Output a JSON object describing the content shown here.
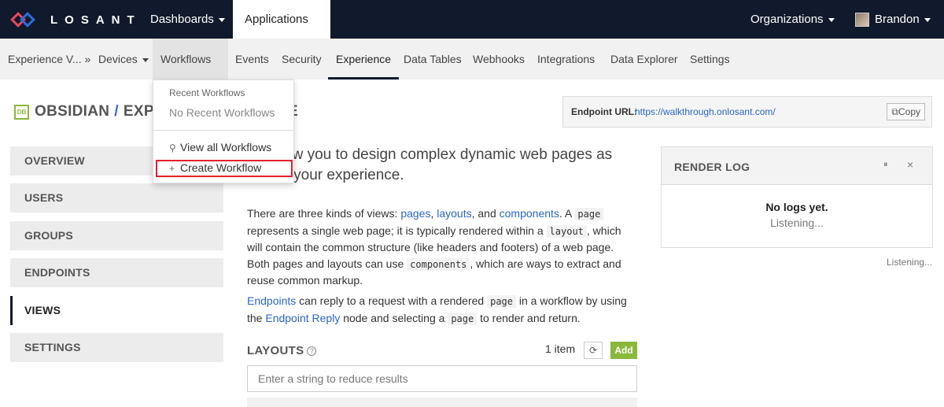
{
  "topbar": {
    "brand": "LOSANT",
    "nav": [
      "Dashboards",
      "Applications"
    ],
    "organizations": "Organizations",
    "user": "Brandon"
  },
  "subnav": {
    "items": [
      "Experience V... »",
      "Devices",
      "Workflows",
      "Events",
      "Security",
      "Experience",
      "Data Tables",
      "Webhooks",
      "Integrations",
      "Data Explorer",
      "Settings"
    ],
    "active": "Experience"
  },
  "dropdown": {
    "header": "Recent Workflows",
    "empty": "No Recent Workflows",
    "view_all": "View all Workflows",
    "create": "Create Workflow"
  },
  "header": {
    "badge": "DB",
    "app": "OBSIDIAN",
    "section": "EXPERIENC",
    "tail": "E"
  },
  "endpoint": {
    "label": "Endpoint URL:",
    "url": "https://walkthrough.onlosant.com/",
    "copy": "Copy"
  },
  "sidebar": {
    "items": [
      "OVERVIEW",
      "USERS",
      "GROUPS",
      "ENDPOINTS",
      "VIEWS",
      "SETTINGS"
    ],
    "active": "VIEWS"
  },
  "main": {
    "lead_line1": "allow you to design complex dynamic web pages as",
    "lead_line2": "part of your experience.",
    "p1": {
      "t1": "There are three kinds of views: ",
      "link_pages": "pages",
      "comma1": ", ",
      "link_layouts": "layouts",
      "t2": ", and ",
      "link_components": "components",
      "t3": ". A ",
      "code_page": "page",
      "t4": " represents a single web page; it is typically rendered within a ",
      "code_layout": "layout",
      "t5": ", which will contain the common structure (like headers and footers) of a web page. Both pages and layouts can use ",
      "code_components": "components",
      "t6": ", which are ways to extract and reuse common markup."
    },
    "p2": {
      "link_endpoints": "Endpoints",
      "t1": " can reply to a request with a rendered ",
      "code_page": "page",
      "t2": " in a workflow by using the ",
      "link_reply": "Endpoint Reply",
      "t3": " node and selecting a ",
      "code_page2": "page",
      "t4": " to render and return."
    },
    "layouts_title": "LAYOUTS",
    "item_count": "1 item",
    "add": "Add",
    "filter_placeholder": "Enter a string to reduce results"
  },
  "render_log": {
    "title": "RENDER LOG",
    "empty": "No logs yet.",
    "listening": "Listening...",
    "status": "Listening..."
  },
  "icons": {
    "help": "?",
    "refresh": "⟳",
    "pause": "⏸",
    "close": "×",
    "search": "⚲",
    "plus": "+",
    "copy": "⧉"
  }
}
